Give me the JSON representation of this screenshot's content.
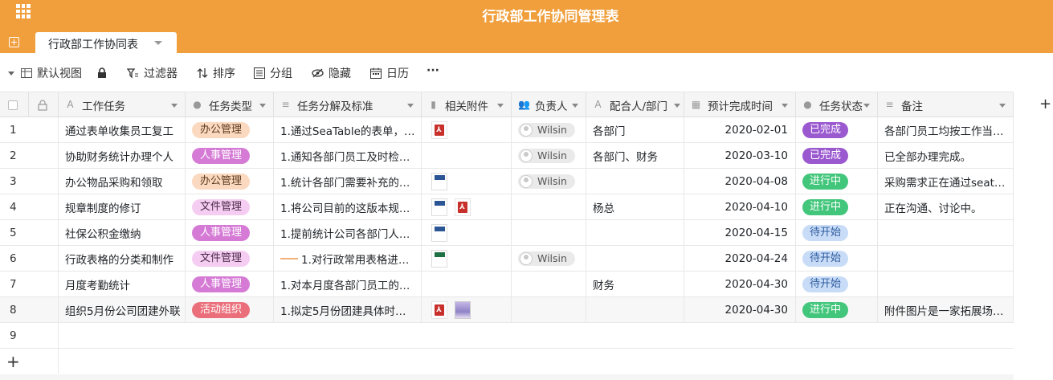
{
  "app": {
    "title": "行政部工作协同管理表",
    "tab_label": "行政部工作协同表"
  },
  "toolbar": {
    "view_label": "默认视图",
    "filter_label": "过滤器",
    "sort_label": "排序",
    "group_label": "分组",
    "hide_label": "隐藏",
    "calendar_label": "日历",
    "more_label": "···"
  },
  "columns": [
    "工作任务",
    "任务类型",
    "任务分解及标准",
    "相关附件",
    "负责人",
    "配合人/部门",
    "预计完成时间",
    "任务状态",
    "备注"
  ],
  "colors": {
    "header": "#f09f3c",
    "done": "#9b59d0",
    "in_progress": "#42c67b",
    "pending_bg": "#c8dcf8",
    "pending_fg": "#2f5d9e"
  },
  "rows": [
    {
      "num": "1",
      "task": "通过表单收集员工复工",
      "type": "办公管理",
      "type_style": "office",
      "detail": "1.通过SeaTable的表单，…",
      "files": [
        "pdf"
      ],
      "owner": "Wilsin",
      "partner": "各部门",
      "date": "2020-02-01",
      "status": "已完成",
      "status_style": "done",
      "note": "各部门员工均按工作当…"
    },
    {
      "num": "2",
      "task": "协助财务统计办理个人",
      "type": "人事管理",
      "type_style": "hr",
      "detail": "1.通知各部门员工及时检…",
      "files": [],
      "owner": "Wilsin",
      "partner": "各部门、财务",
      "date": "2020-03-10",
      "status": "已完成",
      "status_style": "done",
      "note": "已全部办理完成。"
    },
    {
      "num": "3",
      "task": "办公物品采购和领取",
      "type": "办公管理",
      "type_style": "office",
      "detail": "1.统计各部门需要补充的…",
      "files": [
        "doc"
      ],
      "owner": "Wilsin",
      "partner": "",
      "date": "2020-04-08",
      "status": "进行中",
      "status_style": "progress",
      "note": "采购需求正在通过seat…"
    },
    {
      "num": "4",
      "task": "规章制度的修订",
      "type": "文件管理",
      "type_style": "file",
      "detail": "1.将公司目前的这版本规…",
      "files": [
        "doc",
        "pdf"
      ],
      "owner": "",
      "partner": "杨总",
      "date": "2020-04-10",
      "status": "进行中",
      "status_style": "progress",
      "note": "正在沟通、讨论中。"
    },
    {
      "num": "5",
      "task": "社保公积金缴纳",
      "type": "人事管理",
      "type_style": "hr",
      "detail": "1.提前统计公司各部门人…",
      "files": [
        "doc"
      ],
      "owner": "",
      "partner": "",
      "date": "2020-04-15",
      "status": "待开始",
      "status_style": "pending",
      "note": ""
    },
    {
      "num": "6",
      "task": "行政表格的分类和制作",
      "type": "文件管理",
      "type_style": "file",
      "detail": "1.对行政常用表格进…",
      "detail_bar": true,
      "files": [
        "xls"
      ],
      "owner": "Wilsin",
      "partner": "",
      "date": "2020-04-24",
      "status": "待开始",
      "status_style": "pending",
      "note": ""
    },
    {
      "num": "7",
      "task": "月度考勤统计",
      "type": "人事管理",
      "type_style": "hr",
      "detail": "1.对本月度各部门员工的…",
      "files": [],
      "owner": "",
      "partner": "财务",
      "date": "2020-04-30",
      "status": "待开始",
      "status_style": "pending",
      "note": ""
    },
    {
      "num": "8",
      "task": "组织5月份公司团建外联",
      "type": "活动组织",
      "type_style": "event",
      "detail": "1.拟定5月份团建具体时…",
      "files": [
        "pdf",
        "img"
      ],
      "owner": "",
      "partner": "",
      "date": "2020-04-30",
      "status": "进行中",
      "status_style": "progress",
      "note": "附件图片是一家拓展场…"
    }
  ],
  "empty_row_num": "9",
  "add_row_label": "+",
  "add_col_label": "+"
}
